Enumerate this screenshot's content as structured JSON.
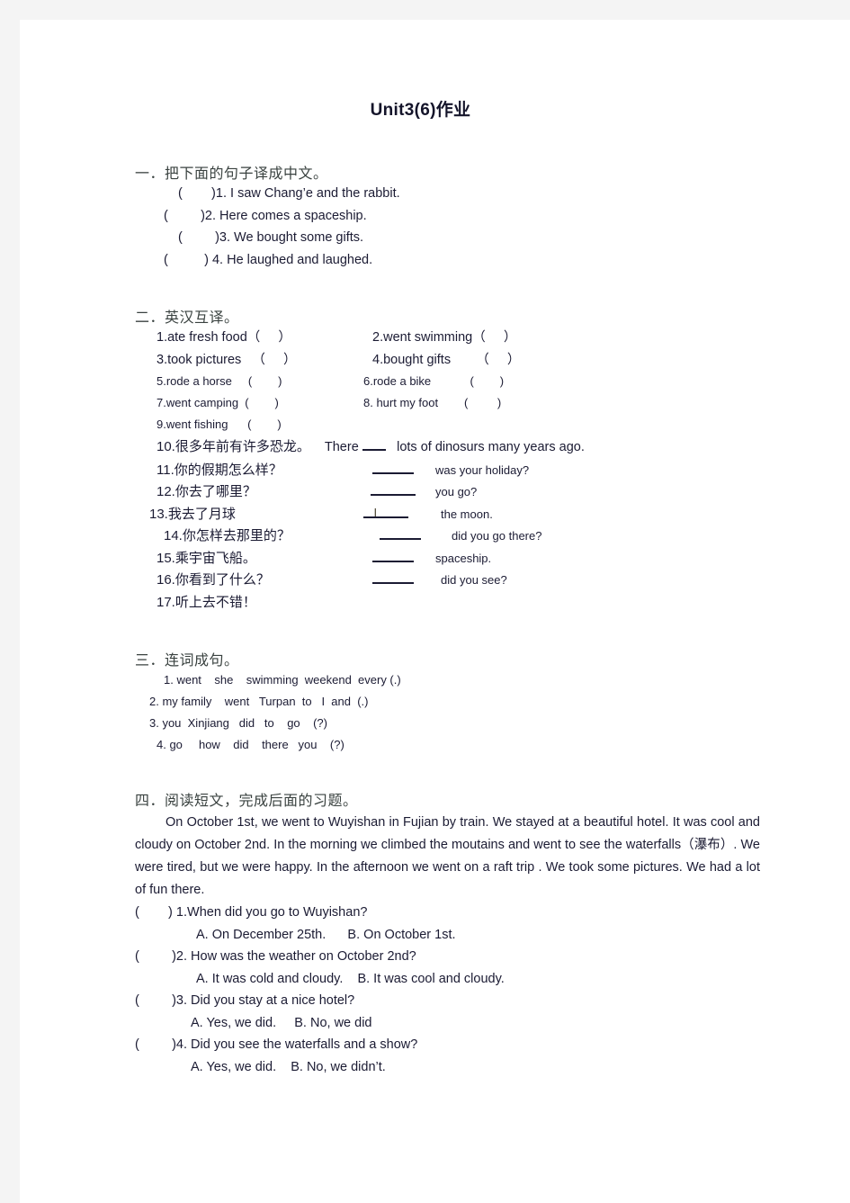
{
  "document": {
    "title": "Unit3(6)作业"
  },
  "section1": {
    "heading": "一．把下面的句子译成中文。",
    "items": [
      "(        )1. I saw Chang’e and the rabbit.",
      "(         )2. Here comes a spaceship.",
      "(         )3. We bought some gifts.",
      "(          ) 4. He laughed and laughed."
    ]
  },
  "section2": {
    "heading": "二．英汉互译。",
    "pairs_large": [
      {
        "left": "1.ate fresh food（     ）",
        "right": "2.went swimming（     ）"
      },
      {
        "left": "3.took pictures   （     ）",
        "right": "4.bought gifts       （     ）"
      }
    ],
    "pairs_small": [
      {
        "left": "5.rode a horse     (        )",
        "right": "6.rode a bike            (        )"
      },
      {
        "left": "7.went camping  (        )",
        "right": "8. hurt my foot        (         )"
      },
      {
        "left": "9.went fishing      (        )",
        "right": ""
      }
    ],
    "translate_items": [
      {
        "num": "10.",
        "cn": "很多年前有许多恐龙。",
        "before": "There",
        "blank": true,
        "after": "lots of dinosurs many years ago.",
        "inline": true
      },
      {
        "num": "11.",
        "cn": "你的假期怎么样？",
        "en": "was your holiday?",
        "blank_w": "w46",
        "answer": ""
      },
      {
        "num": "12.",
        "cn": "你去了哪里？",
        "en": "you go?",
        "blank_w": "w50",
        "answer": ""
      },
      {
        "num": "13.",
        "cn": "我去了月球",
        "en": "the moon.",
        "blank_w": "w50",
        "answer": "I"
      },
      {
        "num": "14.",
        "cn": "你怎样去那里的？",
        "en": "did you go there?",
        "blank_w": "w46",
        "answer": ""
      },
      {
        "num": "15.",
        "cn": "乘宇宙飞船。",
        "en": "spaceship.",
        "blank_w": "w46",
        "answer": ""
      },
      {
        "num": "16.",
        "cn": "你看到了什么？",
        "en": "did you see?",
        "blank_w": "w46",
        "answer": ""
      },
      {
        "num": "17.",
        "cn": "听上去不错！",
        "en": "",
        "blank_w": "",
        "answer": ""
      }
    ]
  },
  "section3": {
    "heading": "三．连词成句。",
    "items": [
      "1. went    she    swimming  weekend  every (.)",
      "2. my family    went   Turpan  to   I  and  (.)",
      "3. you  Xinjiang   did   to    go    (?)",
      "4. go     how    did    there   you    (?)"
    ]
  },
  "section4": {
    "heading": "四．阅读短文，完成后面的习题。",
    "passage": "On October 1st, we went to Wuyishan in Fujian by train. We stayed at a beautiful hotel. It was cool and cloudy on October 2nd. In the morning we climbed the moutains and went to see the waterfalls（瀑布）. We were tired, but we were happy. In the afternoon we went on a raft trip . We took some pictures. We had a lot of fun there.",
    "questions": [
      {
        "stem": "(        ) 1.When did you go to Wuyishan?",
        "options": "A. On December 25th.      B. On October 1st."
      },
      {
        "stem": "(         )2. How was the weather on October 2nd?",
        "options": "A. It was cold and cloudy.    B. It was cool and cloudy."
      },
      {
        "stem": "(         )3. Did you stay at a nice hotel?",
        "options": "A. Yes, we did.     B. No, we did"
      },
      {
        "stem": "(         )4. Did you see the waterfalls and a show?",
        "options": "A. Yes, we did.    B. No, we didn’t."
      }
    ]
  }
}
